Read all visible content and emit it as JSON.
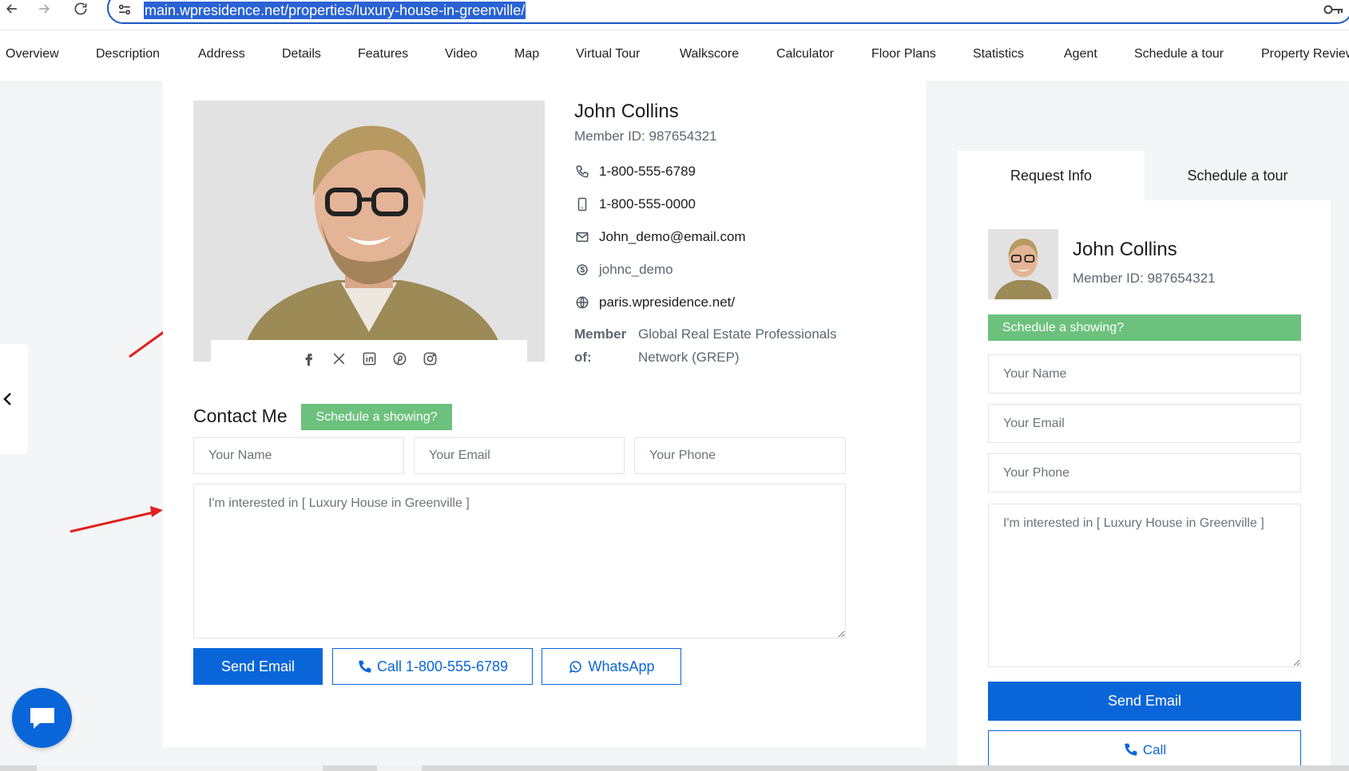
{
  "browser": {
    "url": "main.wpresidence.net/properties/luxury-house-in-greenville/"
  },
  "section_nav": [
    "Overview",
    "Description",
    "Address",
    "Details",
    "Features",
    "Video",
    "Map",
    "Virtual Tour",
    "Walkscore",
    "Calculator",
    "Floor Plans",
    "Statistics",
    "Agent",
    "Schedule a tour",
    "Property Review"
  ],
  "agent": {
    "name": "John Collins",
    "member_id": "Member ID: 987654321",
    "phone": "1-800-555-6789",
    "mobile": "1-800-555-0000",
    "email": "John_demo@email.com",
    "skype": "johnc_demo",
    "website": "paris.wpresidence.net/",
    "member_of_label": "Member of:",
    "member_of_value": "Global Real Estate Professionals Network (GREP)"
  },
  "contact": {
    "title": "Contact Me",
    "schedule_label": "Schedule a showing?",
    "name_placeholder": "Your Name",
    "email_placeholder": "Your Email",
    "phone_placeholder": "Your Phone",
    "message_value": "I'm interested in [ Luxury House in Greenville ]",
    "send_label": "Send Email",
    "call_label": "Call 1-800-555-6789",
    "whatsapp_label": "WhatsApp"
  },
  "side_panel": {
    "tabs": [
      "Request Info",
      "Schedule a tour"
    ],
    "active_tab": "Request Info",
    "name": "John Collins",
    "member_id": "Member ID: 987654321",
    "schedule_label": "Schedule a showing?",
    "name_placeholder": "Your Name",
    "email_placeholder": "Your Email",
    "phone_placeholder": "Your Phone",
    "message_value": "I'm interested in [ Luxury House in Greenville ]",
    "send_label": "Send Email",
    "call_label": "Call"
  },
  "colors": {
    "primary": "#0a66d8",
    "green": "#6cc17c",
    "annotation_arrow": "#e0201b"
  }
}
